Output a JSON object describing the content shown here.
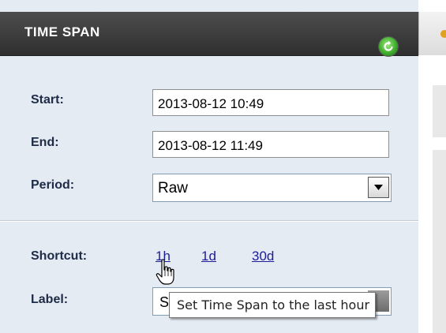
{
  "panel": {
    "title": "TIME SPAN",
    "refresh_icon": "refresh-icon",
    "colors": {
      "header_bg": "#3c3c3c",
      "panel_bg": "#e5ebf3",
      "label_color": "#1d2b46",
      "link_color": "#1c1c99"
    }
  },
  "form": {
    "start_label": "Start:",
    "start_value": "2013-08-12 10:49",
    "end_label": "End:",
    "end_value": "2013-08-12 11:49",
    "period_label": "Period:",
    "period_value": "Raw",
    "shortcut_label": "Shortcut:",
    "shortcuts": [
      "1h",
      "1d",
      "30d"
    ],
    "label_label": "Label:",
    "label_value": "S"
  },
  "tooltip": {
    "text": "Set Time Span to the last hour"
  }
}
